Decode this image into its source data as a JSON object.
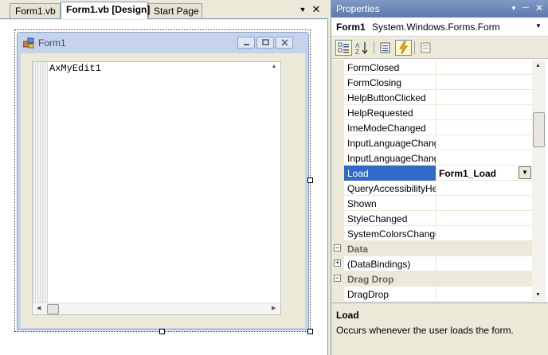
{
  "designer": {
    "tabs": [
      {
        "label": "Form1.vb",
        "active": false
      },
      {
        "label": "Form1.vb [Design]",
        "active": true
      },
      {
        "label": "Start Page",
        "active": false
      }
    ],
    "dropdown_icon": "▼",
    "close_icon": "✕"
  },
  "form": {
    "title": "Form1",
    "activex_text": "AxMyEdit1"
  },
  "properties": {
    "title": "Properties",
    "object_name": "Form1",
    "object_type": "System.Windows.Forms.Form",
    "rows": [
      {
        "name": "FormClosed",
        "value": ""
      },
      {
        "name": "FormClosing",
        "value": ""
      },
      {
        "name": "HelpButtonClicked",
        "value": ""
      },
      {
        "name": "HelpRequested",
        "value": ""
      },
      {
        "name": "ImeModeChanged",
        "value": ""
      },
      {
        "name": "InputLanguageChanged",
        "value": ""
      },
      {
        "name": "InputLanguageChanging",
        "value": ""
      },
      {
        "name": "Load",
        "value": "Form1_Load",
        "selected": true
      },
      {
        "name": "QueryAccessibilityHelp",
        "value": ""
      },
      {
        "name": "Shown",
        "value": ""
      },
      {
        "name": "StyleChanged",
        "value": ""
      },
      {
        "name": "SystemColorsChanged",
        "value": ""
      }
    ],
    "categories": [
      {
        "name": "Data",
        "toggle": "−"
      },
      {
        "name": "Drag Drop",
        "toggle": "−"
      }
    ],
    "data_rows": [
      {
        "name": "(DataBindings)",
        "value": "",
        "toggle": "+"
      }
    ],
    "dragdrop_rows": [
      {
        "name": "DragDrop",
        "value": ""
      }
    ],
    "description": {
      "title": "Load",
      "text": "Occurs whenever the user loads the form."
    }
  },
  "colors": {
    "selection": "#316ac5",
    "titlebar": "#6d88b8",
    "panel": "#ece9d8"
  }
}
